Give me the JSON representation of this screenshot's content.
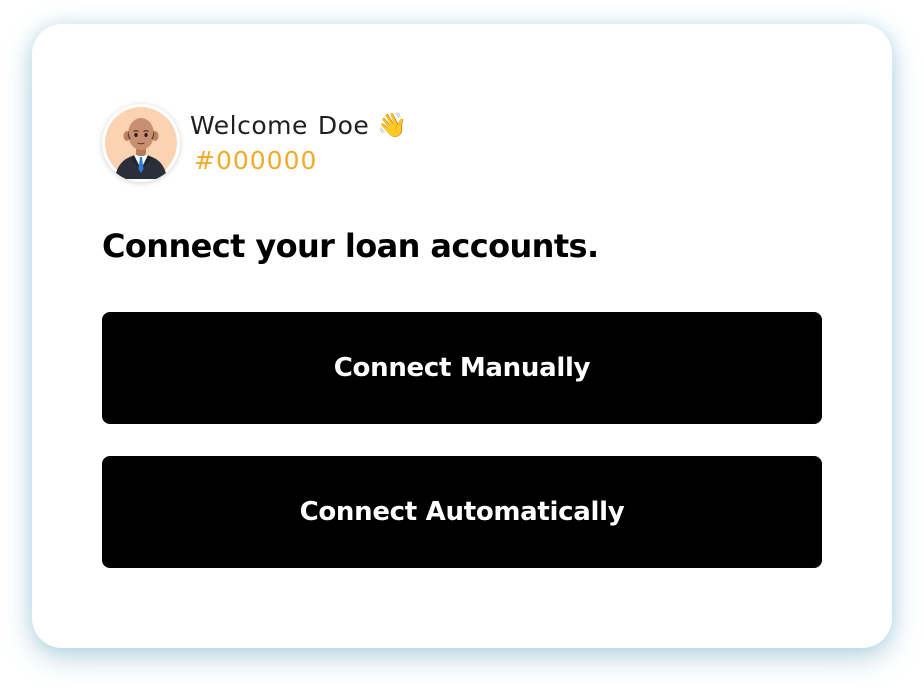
{
  "user": {
    "greeting": "Welcome",
    "name": "Doe",
    "wave_emoji": "👋",
    "id": "#000000"
  },
  "main": {
    "heading": "Connect your loan accounts.",
    "connect_manually_label": "Connect Manually",
    "connect_automatically_label": "Connect Automatically"
  },
  "colors": {
    "id_accent": "#f0ab2b",
    "button_bg": "#000000",
    "card_shadow": "#9ec9d9"
  },
  "icons": {
    "avatar": "user-avatar-icon"
  }
}
